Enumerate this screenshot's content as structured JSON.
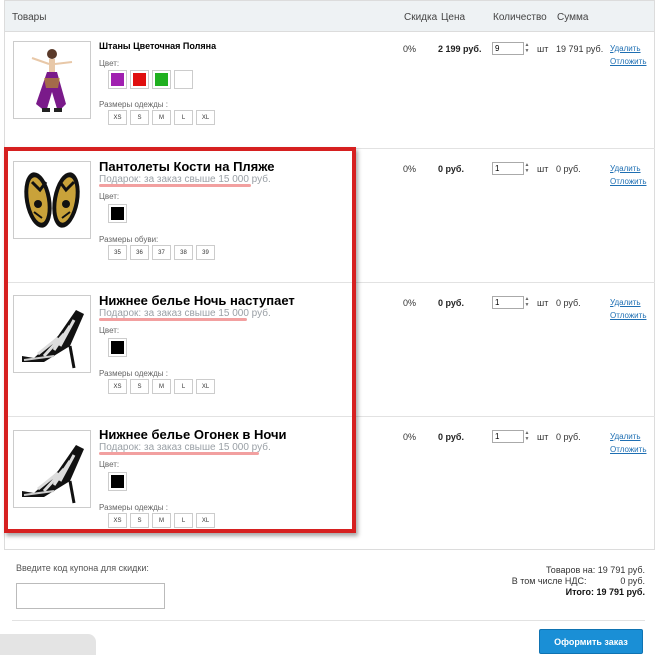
{
  "header": {
    "col_products": "Товары",
    "col_discount": "Скидка",
    "col_price": "Цена",
    "col_quantity": "Количество",
    "col_sum": "Сумма"
  },
  "items": [
    {
      "title": "Штаны Цветочная Поляна",
      "gift": "",
      "color_label": "Цвет:",
      "colors": [
        "#a020b0",
        "#e01010",
        "#20b020",
        "#ffffff"
      ],
      "size_label": "Размеры одежды :",
      "sizes": [
        "XS",
        "S",
        "M",
        "L",
        "XL"
      ],
      "discount": "0%",
      "price": "2 199 руб.",
      "quantity": "9",
      "unit": "шт",
      "sum": "19 791 руб.",
      "delete": "Удалить",
      "postpone": "Отложить",
      "image": "woman-in-purple-pants"
    },
    {
      "title": "Пантолеты Кости на Пляже",
      "gift": "Подарок: за заказ свыше 15 000 руб.",
      "color_label": "Цвет:",
      "colors": [
        "#000000"
      ],
      "size_label": "Размеры обуви:",
      "sizes": [
        "35",
        "36",
        "37",
        "38",
        "39"
      ],
      "discount": "0%",
      "price": "0 руб.",
      "quantity": "1",
      "unit": "шт",
      "sum": "0 руб.",
      "delete": "Удалить",
      "postpone": "Отложить",
      "image": "skull-flip-flops"
    },
    {
      "title": "Нижнее белье Ночь наступает",
      "gift": "Подарок: за заказ свыше 15 000 руб.",
      "color_label": "Цвет:",
      "colors": [
        "#000000"
      ],
      "size_label": "Размеры одежды :",
      "sizes": [
        "XS",
        "S",
        "M",
        "L",
        "XL"
      ],
      "discount": "0%",
      "price": "0 руб.",
      "quantity": "1",
      "unit": "шт",
      "sum": "0 руб.",
      "delete": "Удалить",
      "postpone": "Отложить",
      "image": "striped-high-heel"
    },
    {
      "title": "Нижнее белье Огонек в Ночи",
      "gift": "Подарок: за заказ свыше 15 000 руб.",
      "color_label": "Цвет:",
      "colors": [
        "#000000"
      ],
      "size_label": "Размеры одежды :",
      "sizes": [
        "XS",
        "S",
        "M",
        "L",
        "XL"
      ],
      "discount": "0%",
      "price": "0 руб.",
      "quantity": "1",
      "unit": "шт",
      "sum": "0 руб.",
      "delete": "Удалить",
      "postpone": "Отложить",
      "image": "striped-high-heel"
    }
  ],
  "coupon": {
    "label": "Введите код купона для скидки:",
    "value": ""
  },
  "totals": {
    "goods_label": "Товаров на:",
    "goods_value": "19 791 руб.",
    "vat_label": "В том числе НДС:",
    "vat_value": "0 руб.",
    "total_label": "Итого:",
    "total_value": "19 791 руб."
  },
  "order_button": "Оформить заказ",
  "colors": {
    "accent": "#1a8fd6",
    "link": "#1e6fb3",
    "highlight_frame": "#d62020"
  }
}
